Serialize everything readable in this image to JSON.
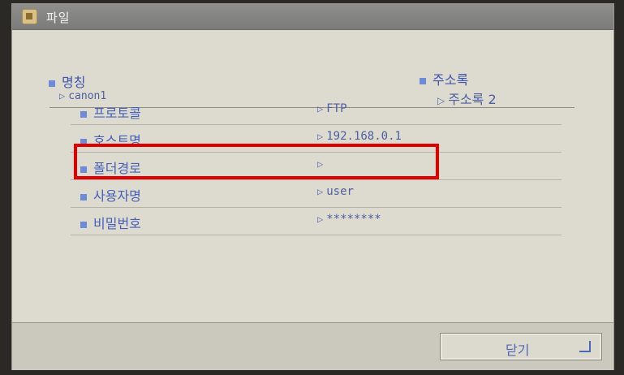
{
  "window": {
    "title": "파일"
  },
  "header": {
    "name_label": "명칭",
    "name_value": "canon1",
    "addressbook_label": "주소록",
    "addressbook_value": "주소록 2"
  },
  "fields": [
    {
      "label": "프로토콜",
      "value": "FTP"
    },
    {
      "label": "호스트명",
      "value": "192.168.0.1"
    },
    {
      "label": "폴더경로",
      "value": ""
    },
    {
      "label": "사용자명",
      "value": "user"
    },
    {
      "label": "비밀번호",
      "value": "********"
    }
  ],
  "footer": {
    "close_label": "닫기"
  },
  "colors": {
    "highlight": "#e00000",
    "accent": "#4660b8"
  },
  "icons": {
    "title": "file-icon",
    "enter": "enter-icon"
  }
}
